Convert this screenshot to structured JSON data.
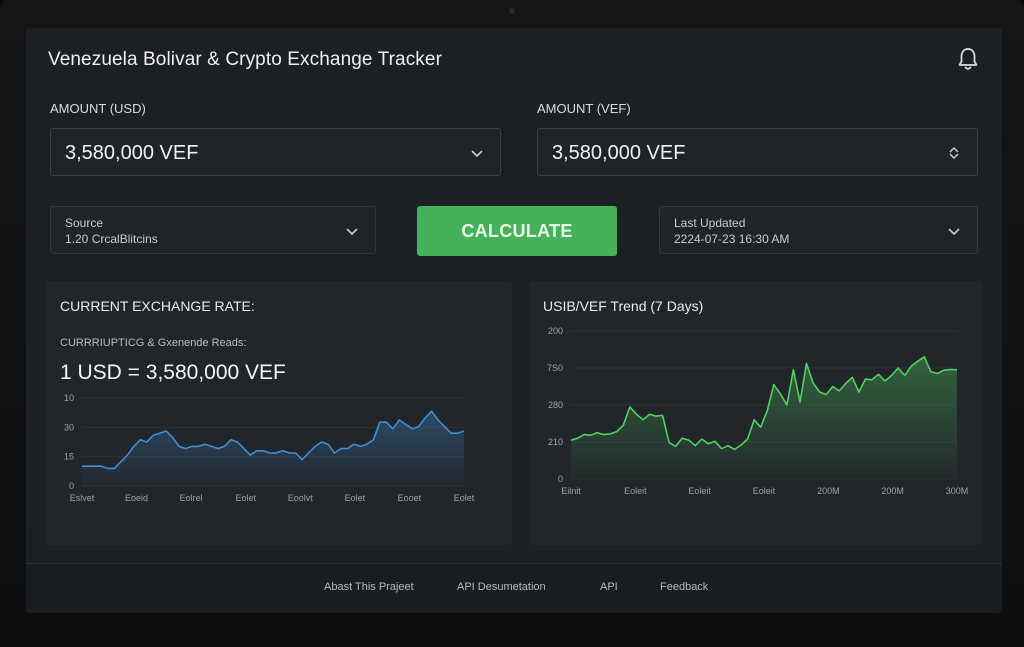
{
  "app": {
    "title": "Venezuela Bolivar & Crypto Exchange Tracker"
  },
  "icons": {
    "notifications": "bell-icon",
    "dropdown": "chevron-down-icon",
    "stepper": "up-down-chevron-icon"
  },
  "colors": {
    "accent_green": "#45b25a",
    "line_blue": "#3f8fd6",
    "line_green": "#4fd15e"
  },
  "amount_usd": {
    "label": "AMOUNT (USD)",
    "value": "3,580,000 VEF"
  },
  "amount_vef": {
    "label": "AMOUNT (VEF)",
    "value": "3,580,000 VEF"
  },
  "source": {
    "label": "Source",
    "value": "1.20  CrcalBlitcins"
  },
  "calculate_label": "CALCULATE",
  "last_updated": {
    "label": "Last Updated",
    "value": "2224-07-23 16:30 AM"
  },
  "rate_panel": {
    "title": "CURRENT EXCHANGE RATE:",
    "subtitle": "CURRRIUPTICG & Gxenende Reads:",
    "rate_text": "1 USD = 3,580,000 VEF"
  },
  "trend_panel": {
    "title": "USIB/VEF Trend (7 Days)"
  },
  "chart_data": [
    {
      "type": "area",
      "title": "",
      "y_ticks": [
        "10",
        "30",
        "15",
        "0"
      ],
      "x_ticks": [
        "Eslvet",
        "Eoeid",
        "Eolrel",
        "Eolet",
        "Eoolvt",
        "Eolet",
        "Eooet",
        "Eolet"
      ],
      "ylim": [
        0,
        40
      ],
      "x": [
        0,
        1,
        2,
        3,
        4,
        5,
        6,
        7,
        8,
        9,
        10,
        11,
        12,
        13,
        14,
        15,
        16,
        17,
        18,
        19,
        20,
        21,
        22,
        23,
        24,
        25,
        26,
        27,
        28,
        29,
        30,
        31,
        32,
        33,
        34,
        35,
        36,
        37,
        38,
        39,
        40,
        41,
        42,
        43,
        44,
        45,
        46,
        47,
        48,
        49,
        50,
        51,
        52,
        53,
        54,
        55,
        56,
        57,
        58,
        59
      ],
      "series": [
        {
          "values": [
            9,
            9,
            9,
            9,
            8,
            8,
            11,
            14,
            18,
            21,
            20,
            23,
            24,
            25,
            22,
            18,
            17,
            18,
            18,
            19,
            18,
            17,
            18,
            21,
            20,
            17,
            14,
            16,
            16,
            15,
            15,
            16,
            15,
            15,
            12,
            15,
            18,
            20,
            19,
            15,
            17,
            17,
            19,
            18,
            19,
            21,
            29,
            29,
            26,
            30,
            28,
            26,
            27,
            31,
            34,
            30,
            27,
            24,
            24,
            25
          ]
        }
      ]
    },
    {
      "type": "area",
      "title": "USIB/VEF Trend (7 Days)",
      "y_ticks": [
        "200",
        "7S0",
        "280",
        "210",
        "0"
      ],
      "x_ticks": [
        "Eilnit",
        "Eoleit",
        "Eoleit",
        "Eoleit",
        "200M",
        "200M",
        "300M"
      ],
      "ylim": [
        0,
        400
      ],
      "x": [
        0,
        1,
        2,
        3,
        4,
        5,
        6,
        7,
        8,
        9,
        10,
        11,
        12,
        13,
        14,
        15,
        16,
        17,
        18,
        19,
        20,
        21,
        22,
        23,
        24,
        25,
        26,
        27,
        28,
        29,
        30,
        31,
        32,
        33,
        34,
        35,
        36,
        37,
        38,
        39,
        40,
        41,
        42,
        43,
        44,
        45,
        46,
        47,
        48,
        49,
        50,
        51,
        52,
        53,
        54,
        55,
        56,
        57,
        58,
        59
      ],
      "series": [
        {
          "values": [
            105,
            110,
            120,
            118,
            125,
            120,
            122,
            128,
            145,
            195,
            175,
            160,
            175,
            170,
            172,
            98,
            88,
            110,
            105,
            90,
            108,
            95,
            102,
            82,
            90,
            80,
            92,
            108,
            160,
            140,
            185,
            255,
            230,
            200,
            295,
            208,
            312,
            260,
            235,
            228,
            250,
            238,
            258,
            275,
            235,
            270,
            268,
            283,
            265,
            280,
            300,
            280,
            305,
            318,
            330,
            290,
            285,
            294,
            296,
            295
          ]
        }
      ]
    }
  ],
  "footer": {
    "links": [
      "Abast This Prajeet",
      "API Desumetation",
      "API",
      "Feedback"
    ]
  }
}
